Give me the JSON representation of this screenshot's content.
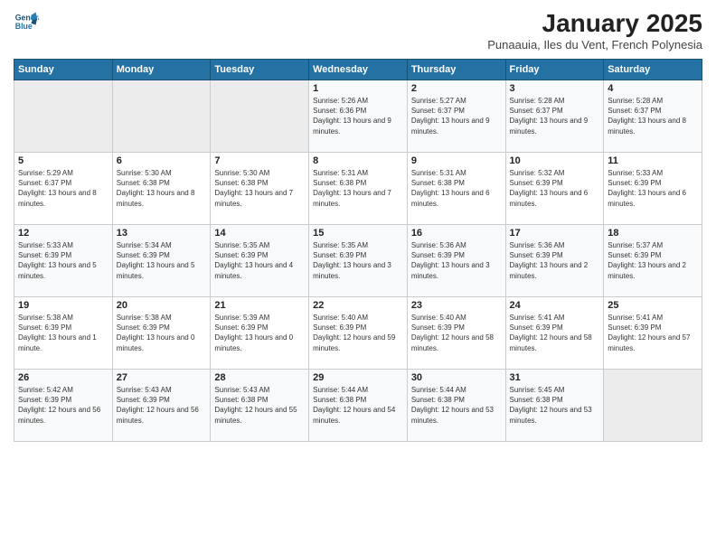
{
  "logo": {
    "line1": "General",
    "line2": "Blue"
  },
  "title": "January 2025",
  "subtitle": "Punaauia, Iles du Vent, French Polynesia",
  "days_header": [
    "Sunday",
    "Monday",
    "Tuesday",
    "Wednesday",
    "Thursday",
    "Friday",
    "Saturday"
  ],
  "weeks": [
    [
      {
        "day": "",
        "empty": true
      },
      {
        "day": "",
        "empty": true
      },
      {
        "day": "",
        "empty": true
      },
      {
        "day": "1",
        "rise": "5:26 AM",
        "set": "6:36 PM",
        "daylight": "13 hours and 9 minutes."
      },
      {
        "day": "2",
        "rise": "5:27 AM",
        "set": "6:37 PM",
        "daylight": "13 hours and 9 minutes."
      },
      {
        "day": "3",
        "rise": "5:28 AM",
        "set": "6:37 PM",
        "daylight": "13 hours and 9 minutes."
      },
      {
        "day": "4",
        "rise": "5:28 AM",
        "set": "6:37 PM",
        "daylight": "13 hours and 8 minutes."
      }
    ],
    [
      {
        "day": "5",
        "rise": "5:29 AM",
        "set": "6:37 PM",
        "daylight": "13 hours and 8 minutes."
      },
      {
        "day": "6",
        "rise": "5:30 AM",
        "set": "6:38 PM",
        "daylight": "13 hours and 8 minutes."
      },
      {
        "day": "7",
        "rise": "5:30 AM",
        "set": "6:38 PM",
        "daylight": "13 hours and 7 minutes."
      },
      {
        "day": "8",
        "rise": "5:31 AM",
        "set": "6:38 PM",
        "daylight": "13 hours and 7 minutes."
      },
      {
        "day": "9",
        "rise": "5:31 AM",
        "set": "6:38 PM",
        "daylight": "13 hours and 6 minutes."
      },
      {
        "day": "10",
        "rise": "5:32 AM",
        "set": "6:39 PM",
        "daylight": "13 hours and 6 minutes."
      },
      {
        "day": "11",
        "rise": "5:33 AM",
        "set": "6:39 PM",
        "daylight": "13 hours and 6 minutes."
      }
    ],
    [
      {
        "day": "12",
        "rise": "5:33 AM",
        "set": "6:39 PM",
        "daylight": "13 hours and 5 minutes."
      },
      {
        "day": "13",
        "rise": "5:34 AM",
        "set": "6:39 PM",
        "daylight": "13 hours and 5 minutes."
      },
      {
        "day": "14",
        "rise": "5:35 AM",
        "set": "6:39 PM",
        "daylight": "13 hours and 4 minutes."
      },
      {
        "day": "15",
        "rise": "5:35 AM",
        "set": "6:39 PM",
        "daylight": "13 hours and 3 minutes."
      },
      {
        "day": "16",
        "rise": "5:36 AM",
        "set": "6:39 PM",
        "daylight": "13 hours and 3 minutes."
      },
      {
        "day": "17",
        "rise": "5:36 AM",
        "set": "6:39 PM",
        "daylight": "13 hours and 2 minutes."
      },
      {
        "day": "18",
        "rise": "5:37 AM",
        "set": "6:39 PM",
        "daylight": "13 hours and 2 minutes."
      }
    ],
    [
      {
        "day": "19",
        "rise": "5:38 AM",
        "set": "6:39 PM",
        "daylight": "13 hours and 1 minute."
      },
      {
        "day": "20",
        "rise": "5:38 AM",
        "set": "6:39 PM",
        "daylight": "13 hours and 0 minutes."
      },
      {
        "day": "21",
        "rise": "5:39 AM",
        "set": "6:39 PM",
        "daylight": "13 hours and 0 minutes."
      },
      {
        "day": "22",
        "rise": "5:40 AM",
        "set": "6:39 PM",
        "daylight": "12 hours and 59 minutes."
      },
      {
        "day": "23",
        "rise": "5:40 AM",
        "set": "6:39 PM",
        "daylight": "12 hours and 58 minutes."
      },
      {
        "day": "24",
        "rise": "5:41 AM",
        "set": "6:39 PM",
        "daylight": "12 hours and 58 minutes."
      },
      {
        "day": "25",
        "rise": "5:41 AM",
        "set": "6:39 PM",
        "daylight": "12 hours and 57 minutes."
      }
    ],
    [
      {
        "day": "26",
        "rise": "5:42 AM",
        "set": "6:39 PM",
        "daylight": "12 hours and 56 minutes."
      },
      {
        "day": "27",
        "rise": "5:43 AM",
        "set": "6:39 PM",
        "daylight": "12 hours and 56 minutes."
      },
      {
        "day": "28",
        "rise": "5:43 AM",
        "set": "6:38 PM",
        "daylight": "12 hours and 55 minutes."
      },
      {
        "day": "29",
        "rise": "5:44 AM",
        "set": "6:38 PM",
        "daylight": "12 hours and 54 minutes."
      },
      {
        "day": "30",
        "rise": "5:44 AM",
        "set": "6:38 PM",
        "daylight": "12 hours and 53 minutes."
      },
      {
        "day": "31",
        "rise": "5:45 AM",
        "set": "6:38 PM",
        "daylight": "12 hours and 53 minutes."
      },
      {
        "day": "",
        "empty": true
      }
    ]
  ],
  "labels": {
    "sunrise": "Sunrise:",
    "sunset": "Sunset:",
    "daylight": "Daylight:"
  }
}
